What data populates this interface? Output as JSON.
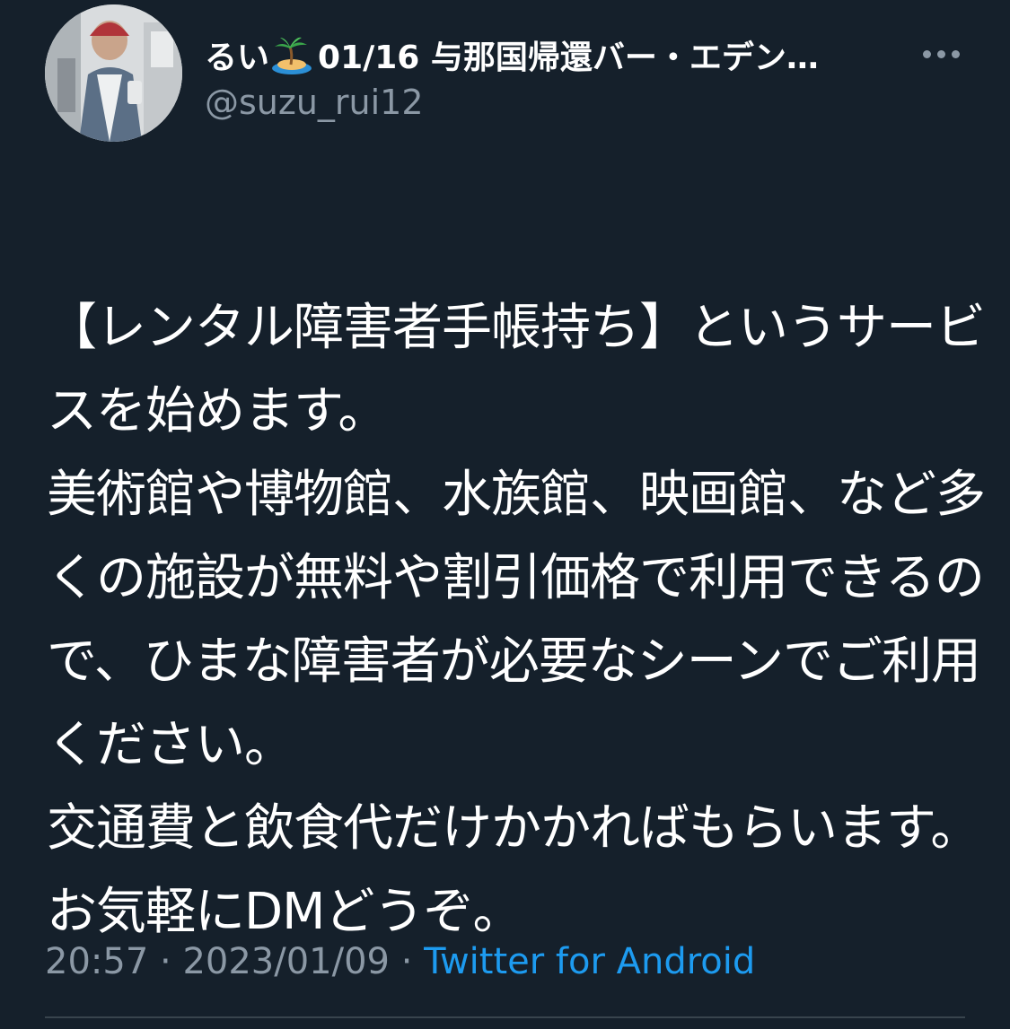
{
  "author": {
    "display_name_prefix": "るい",
    "display_name_suffix": "01/16 与那国帰還バー・エデン…",
    "handle": "@suzu_rui12"
  },
  "icons": {
    "island": "desert-island-emoji",
    "more": "more-horizontal-icon",
    "avatar": "profile-photo"
  },
  "tweet": {
    "lines": [
      "【レンタル障害者手帳持ち】というサービスを始めます。",
      "美術館や博物館、水族館、映画館、など多くの施設が無料や割引価格で利用できるので、ひまな障害者が必要なシーンでご利用ください。",
      "交通費と飲食代だけかかればもらいます。お気軽にDMどうぞ。"
    ]
  },
  "meta": {
    "time": "20:57",
    "separator": " · ",
    "date": "2023/01/09",
    "source": "Twitter for Android"
  },
  "colors": {
    "background": "#15202b",
    "text": "#ffffff",
    "secondary": "#8b98a5",
    "link": "#1d9bf0"
  }
}
